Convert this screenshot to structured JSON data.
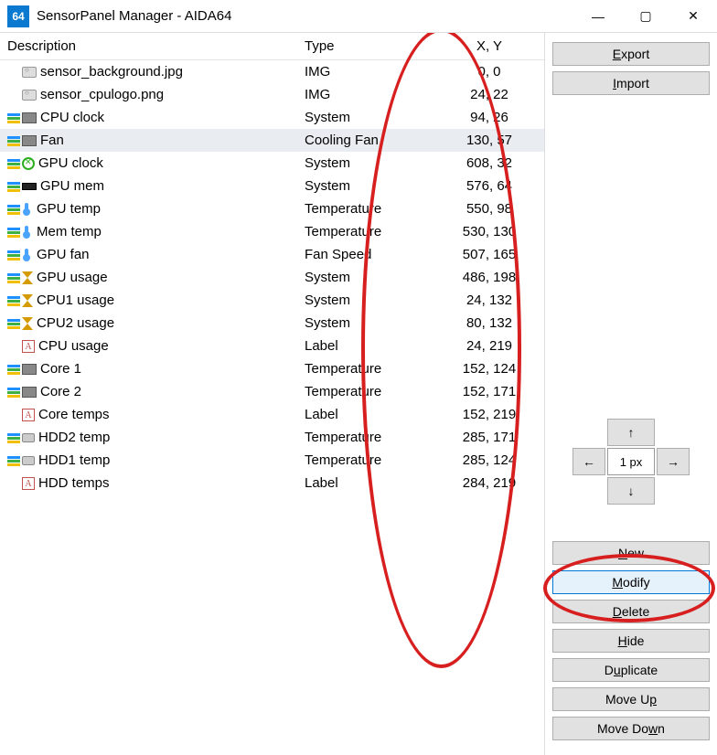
{
  "window": {
    "title": "SensorPanel Manager - AIDA64",
    "icon_text": "64"
  },
  "columns": {
    "c0": "Description",
    "c1": "Type",
    "c2": "X, Y"
  },
  "rows": [
    {
      "icon": "img",
      "desc": "sensor_background.jpg",
      "type": "IMG",
      "xy": "0, 0",
      "selected": false
    },
    {
      "icon": "img",
      "desc": "sensor_cpulogo.png",
      "type": "IMG",
      "xy": "24, 22",
      "selected": false
    },
    {
      "icon": "chip",
      "desc": "CPU clock",
      "type": "System",
      "xy": "94, 26",
      "selected": false
    },
    {
      "icon": "chip",
      "desc": "Fan",
      "type": "Cooling Fan",
      "xy": "130, 57",
      "selected": true
    },
    {
      "icon": "xbox",
      "desc": "GPU clock",
      "type": "System",
      "xy": "608, 32",
      "selected": false
    },
    {
      "icon": "ram",
      "desc": "GPU mem",
      "type": "System",
      "xy": "576, 64",
      "selected": false
    },
    {
      "icon": "therm",
      "desc": "GPU temp",
      "type": "Temperature",
      "xy": "550, 98",
      "selected": false
    },
    {
      "icon": "therm",
      "desc": "Mem temp",
      "type": "Temperature",
      "xy": "530, 130",
      "selected": false
    },
    {
      "icon": "therm",
      "desc": "GPU fan",
      "type": "Fan Speed",
      "xy": "507, 165",
      "selected": false
    },
    {
      "icon": "hour",
      "desc": "GPU usage",
      "type": "System",
      "xy": "486, 198",
      "selected": false
    },
    {
      "icon": "hour",
      "desc": "CPU1 usage",
      "type": "System",
      "xy": "24, 132",
      "selected": false
    },
    {
      "icon": "hour",
      "desc": "CPU2 usage",
      "type": "System",
      "xy": "80, 132",
      "selected": false
    },
    {
      "icon": "label",
      "desc": "CPU usage",
      "type": "Label",
      "xy": "24, 219",
      "selected": false
    },
    {
      "icon": "chip",
      "desc": "Core 1",
      "type": "Temperature",
      "xy": "152, 124",
      "selected": false
    },
    {
      "icon": "chip",
      "desc": "Core 2",
      "type": "Temperature",
      "xy": "152, 171",
      "selected": false
    },
    {
      "icon": "label",
      "desc": "Core temps",
      "type": "Label",
      "xy": "152, 219",
      "selected": false
    },
    {
      "icon": "hdd",
      "desc": "HDD2 temp",
      "type": "Temperature",
      "xy": "285, 171",
      "selected": false
    },
    {
      "icon": "hdd",
      "desc": "HDD1 temp",
      "type": "Temperature",
      "xy": "285, 124",
      "selected": false
    },
    {
      "icon": "label",
      "desc": "HDD temps",
      "type": "Label",
      "xy": "284, 219",
      "selected": false
    }
  ],
  "side": {
    "export": "Export",
    "import": "Import",
    "px_label": "1 px",
    "new": "New",
    "modify": "Modify",
    "delete": "Delete",
    "hide": "Hide",
    "duplicate": "Duplicate",
    "moveup": "Move Up",
    "movedown": "Move Down"
  }
}
